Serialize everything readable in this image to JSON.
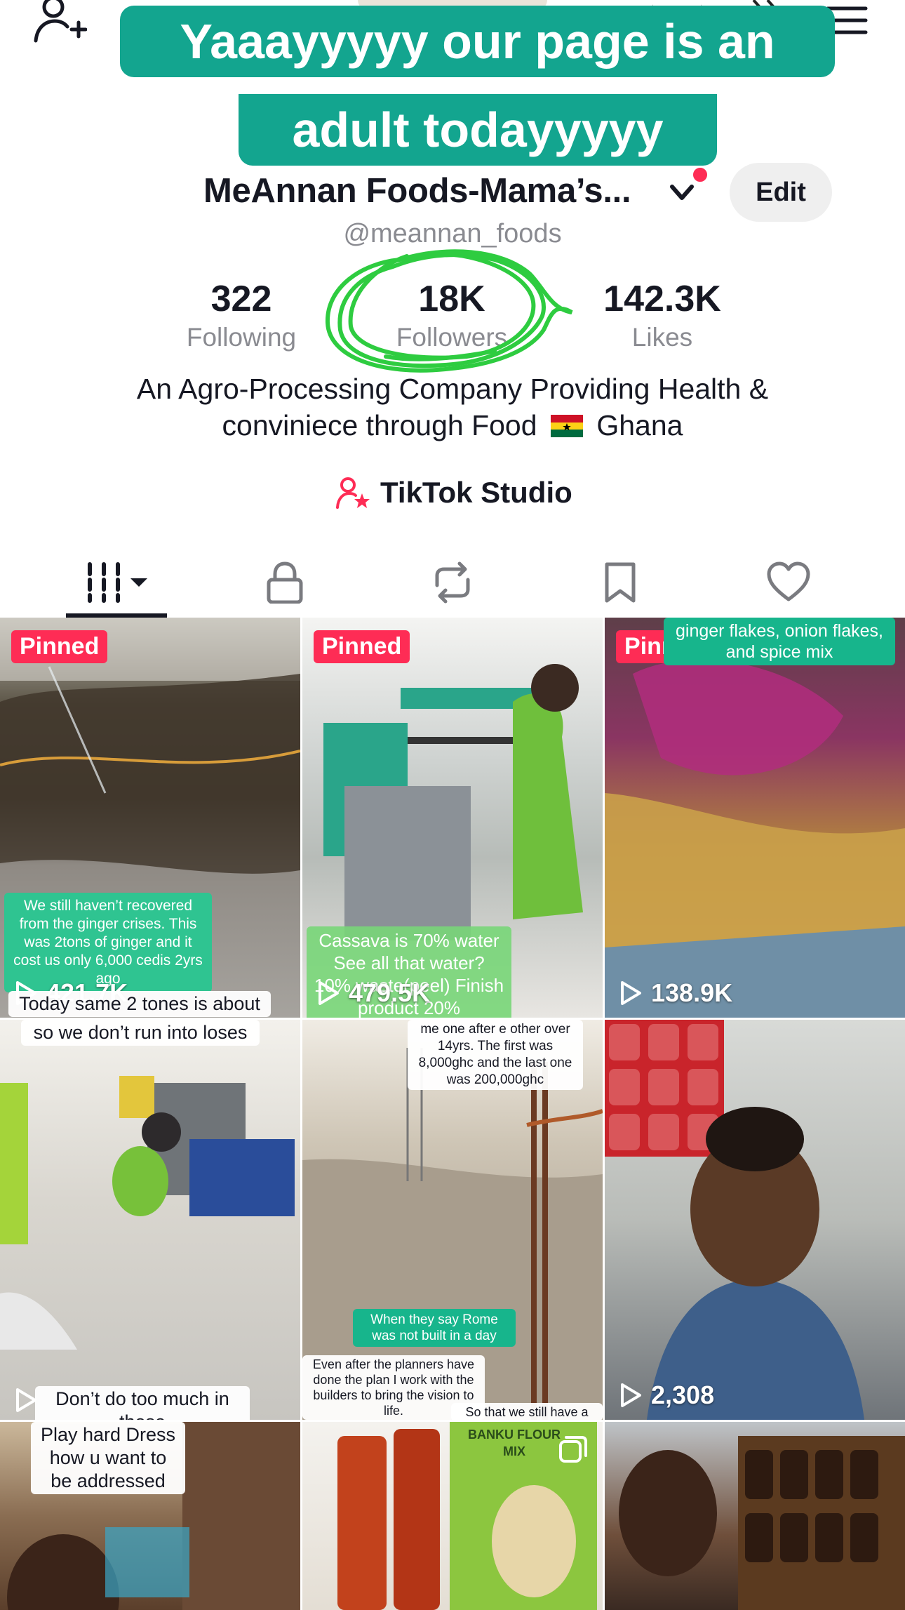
{
  "caption": {
    "line1": "Yaaayyyyy our page is an",
    "line2": "adult todayyyyy"
  },
  "profile": {
    "name": "MeAnnan Foods-Mama’s...",
    "handle": "@meannan_foods",
    "edit_label": "Edit",
    "stats": {
      "following_count": "322",
      "following_label": "Following",
      "followers_count": "18K",
      "followers_label": "Followers",
      "likes_count": "142.3K",
      "likes_label": "Likes"
    },
    "bio_line1": "An Agro-Processing Company Providing Health &",
    "bio_line2a": "conviniece through Food",
    "bio_line2b": "Ghana",
    "studio_label": "TikTok Studio"
  },
  "colors": {
    "accent": "#fe2c55",
    "caption_bg": "#13a58f",
    "highlight_scribble": "#2ecc40"
  },
  "icons": [
    "add-user-icon",
    "menu-icon",
    "chevron-down-icon",
    "tiktok-studio-icon",
    "videos-grid-icon",
    "lock-icon",
    "repost-icon",
    "bookmark-icon",
    "heart-icon",
    "play-icon",
    "multi-photo-icon"
  ],
  "videos": [
    {
      "pinned_label": "Pinned",
      "views": "421.7K",
      "text_green": "We still haven’t recovered from the ginger crises. This was 2tons of ginger and it cost us only 6,000 cedis 2yrs ago",
      "text_white": "Today same 2 tones is about"
    },
    {
      "pinned_label": "Pinned",
      "views": "479.5K",
      "text_green": "Cassava is 70% water See all that water? 10% waste(peel) Finish product 20%"
    },
    {
      "pinned_label": "Pinned",
      "views": "138.9K",
      "text_teal": "ginger flakes, onion flakes, and spice mix"
    },
    {
      "text_white_top": "so we don’t run into loses",
      "text_white_bottom": "Don’t do too much in these"
    },
    {
      "text_white_top": "me one after e other over 14yrs. The first was 8,000ghc and the last one was 200,000ghc",
      "text_teal": "When they say Rome was not built in a day",
      "text_white_bottom": "Even after the planners have done the plan I work with the builders to bring the vision to life.",
      "text_white_bottom2": "So that we still have a"
    },
    {
      "views": "2,308"
    },
    {
      "text_white_top": "Play hard Dress how u want to be addressed"
    },
    {
      "text_product": "BANKU FLOUR MIX"
    },
    {}
  ]
}
